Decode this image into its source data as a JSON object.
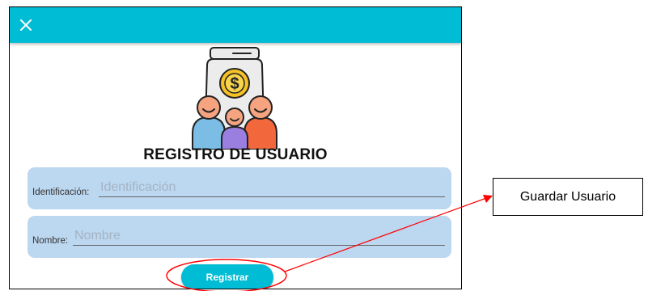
{
  "toolbar": {
    "close_icon": "close-icon",
    "color": "#00bcd4"
  },
  "logo": {
    "icon": "family-savings-jar-icon",
    "currency_symbol": "$"
  },
  "form": {
    "title": "REGISTRO DE USUARIO",
    "identification": {
      "label": "Identificación:",
      "placeholder": "Identificación",
      "value": ""
    },
    "name": {
      "label": "Nombre:",
      "placeholder": "Nombre",
      "value": ""
    },
    "submit_label": "Registrar"
  },
  "annotation": {
    "text": "Guardar Usuario",
    "color": "#ff0000"
  },
  "colors": {
    "accent": "#00bcd4",
    "field_background": "#bcd7f0"
  }
}
